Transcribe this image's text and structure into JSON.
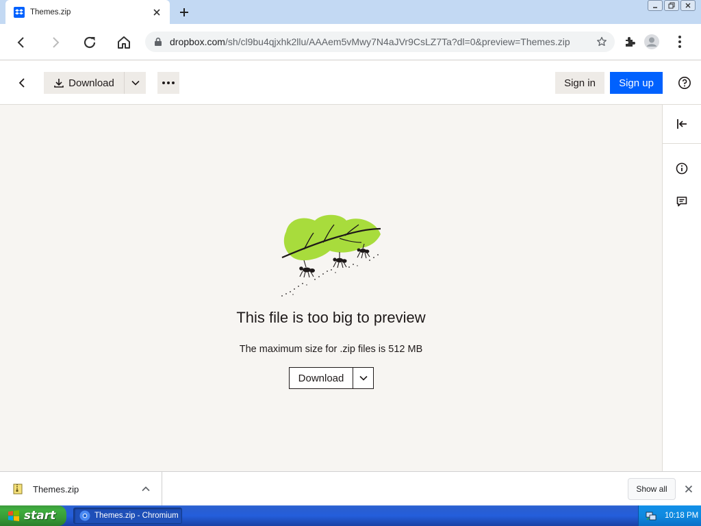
{
  "browser": {
    "tab": {
      "title": "Themes.zip",
      "favicon": "dropbox-icon"
    },
    "url": {
      "domain": "dropbox.com",
      "path": "/sh/cl9bu4qjxhk2llu/AAAem5vMwy7N4aJVr9CsLZ7Ta?dl=0&preview=Themes.zip"
    }
  },
  "header": {
    "download_label": "Download",
    "signin_label": "Sign in",
    "signup_label": "Sign up"
  },
  "preview": {
    "title": "This file is too big to preview",
    "subtitle": "The maximum size for .zip files is 512 MB",
    "download_label": "Download"
  },
  "download_shelf": {
    "file_name": "Themes.zip",
    "show_all_label": "Show all"
  },
  "taskbar": {
    "start_label": "start",
    "task_label": "Themes.zip - Chromium",
    "clock": "10:18 PM"
  },
  "colors": {
    "accent_blue": "#0061fe",
    "leaf_green": "#a8dc3c",
    "page_bg": "#f7f5f2"
  }
}
